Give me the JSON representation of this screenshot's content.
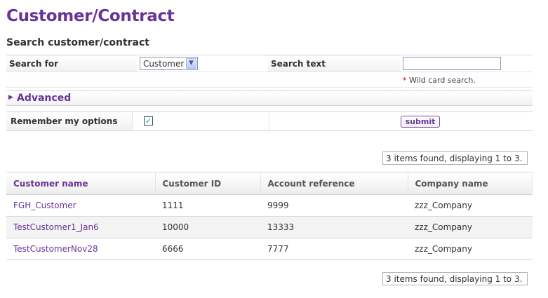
{
  "page": {
    "title": "Customer/Contract",
    "section_title": "Search customer/contract"
  },
  "search": {
    "search_for_label": "Search for",
    "search_for_value": "Customer",
    "search_text_label": "Search text",
    "search_text_value": "",
    "wild_card_star": "*",
    "wild_card_note": "Wild card search."
  },
  "advanced": {
    "label": "Advanced"
  },
  "options": {
    "remember_label": "Remember my options",
    "remember_checked": true,
    "submit_label": "submit"
  },
  "results": {
    "count_text_top": "3 items found, displaying 1 to 3.",
    "count_text_bottom": "3 items found, displaying 1 to 3.",
    "columns": [
      "Customer name",
      "Customer ID",
      "Account reference",
      "Company name"
    ],
    "rows": [
      [
        "FGH_Customer",
        "1111",
        "9999",
        "zzz_Company"
      ],
      [
        "TestCustomer1_Jan6",
        "10000",
        "13333",
        "zzz_Company"
      ],
      [
        "TestCustomerNov28",
        "6666",
        "7777",
        "zzz_Company"
      ]
    ]
  },
  "colors": {
    "accent": "#6b3399",
    "check": "#21a121",
    "required": "#cc0000"
  },
  "icons": {
    "select_arrow": "chevron-down-icon",
    "advanced_arrow": "triangle-right-icon",
    "checkbox": "check-icon"
  }
}
